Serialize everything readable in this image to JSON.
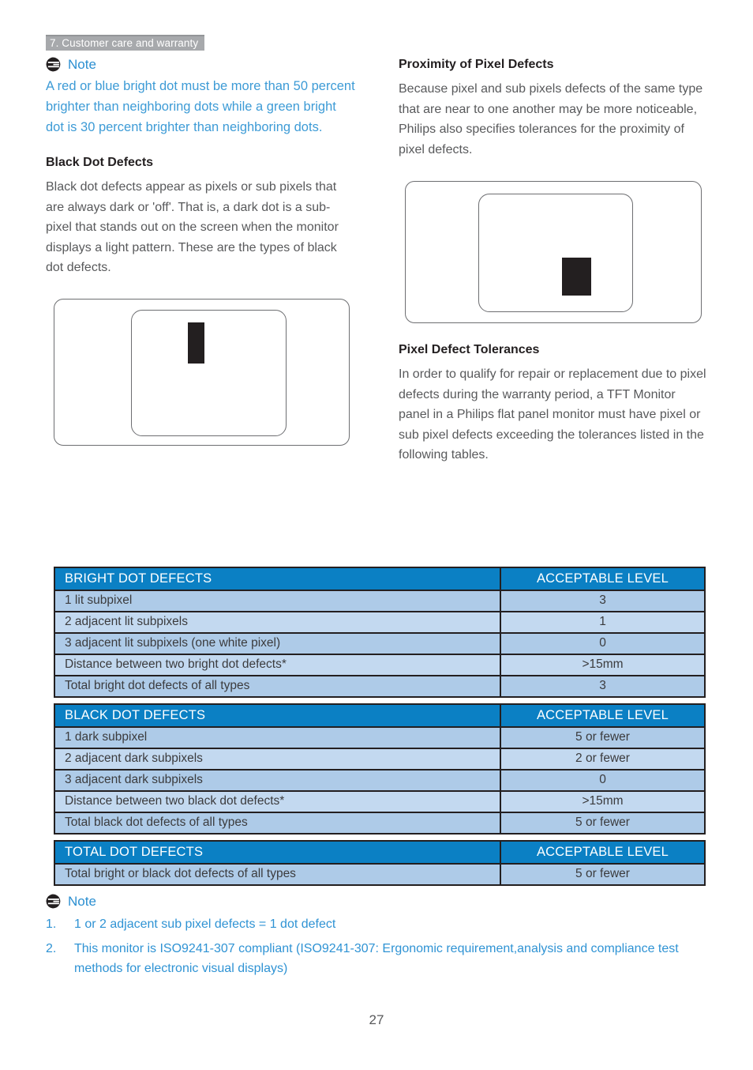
{
  "header": {
    "chapter": "7. Customer care and warranty"
  },
  "left_column": {
    "note": {
      "icon": "note-icon",
      "title": "Note",
      "body": "A red or blue bright dot must be more than 50 percent brighter than neighboring dots while a green bright dot is 30 percent brighter than neighboring dots."
    },
    "section": {
      "heading": "Black Dot Defects",
      "body": "Black dot defects appear as pixels or sub pixels that are always dark or 'off'. That is, a dark dot is a sub-pixel that stands out on the screen when the monitor displays a light pattern. These are the types of black dot defects."
    },
    "figure": {
      "name": "black-dot-defect-diagram"
    }
  },
  "right_column": {
    "proximity": {
      "heading": "Proximity of Pixel Defects",
      "body": "Because pixel and sub pixels defects of the same type that are near to one another may be more noticeable, Philips also specifies tolerances for the proximity of pixel defects."
    },
    "figure": {
      "name": "pixel-defect-proximity-diagram"
    },
    "tolerances": {
      "heading": "Pixel Defect Tolerances",
      "body": "In order to qualify for repair or replacement due to pixel defects during the warranty period, a TFT Monitor panel in a Philips flat panel monitor must have pixel or sub pixel defects exceeding the tolerances listed in the following tables."
    }
  },
  "tables": [
    {
      "id": "bright-dot-defects",
      "headers": [
        "BRIGHT DOT DEFECTS",
        "ACCEPTABLE LEVEL"
      ],
      "rows": [
        [
          "1 lit subpixel",
          "3"
        ],
        [
          "2 adjacent lit subpixels",
          "1"
        ],
        [
          "3 adjacent lit subpixels (one white pixel)",
          "0"
        ],
        [
          "Distance between two bright dot defects*",
          ">15mm"
        ],
        [
          "Total bright dot defects of all types",
          "3"
        ]
      ]
    },
    {
      "id": "black-dot-defects",
      "headers": [
        "BLACK DOT DEFECTS",
        "ACCEPTABLE LEVEL"
      ],
      "rows": [
        [
          "1 dark subpixel",
          "5 or fewer"
        ],
        [
          "2 adjacent dark subpixels",
          "2 or fewer"
        ],
        [
          "3 adjacent dark subpixels",
          "0"
        ],
        [
          "Distance between two black dot defects*",
          ">15mm"
        ],
        [
          "Total black dot defects of all types",
          "5 or fewer"
        ]
      ]
    },
    {
      "id": "total-dot-defects",
      "headers": [
        "TOTAL DOT DEFECTS",
        "ACCEPTABLE LEVEL"
      ],
      "rows": [
        [
          "Total bright or black dot defects of all types",
          "5 or fewer"
        ]
      ]
    }
  ],
  "bottom_note": {
    "icon": "note-icon",
    "title": "Note",
    "items": [
      {
        "num": "1.",
        "text": "1 or 2 adjacent sub pixel defects = 1 dot defect"
      },
      {
        "num": "2.",
        "text": "This monitor is ISO9241-307 compliant (ISO9241-307: Ergonomic requirement,analysis and compliance test methods for electronic visual displays)"
      }
    ]
  },
  "footer": {
    "page_number": "27"
  },
  "colors": {
    "header_bar": "#a7a9ac",
    "note_blue": "#3d9bd6",
    "table_header_blue": "#0b80c4",
    "row_odd": "#aecbe8",
    "row_even": "#c3d9f0",
    "body_gray": "#58595b",
    "dot_black": "#231f20"
  }
}
